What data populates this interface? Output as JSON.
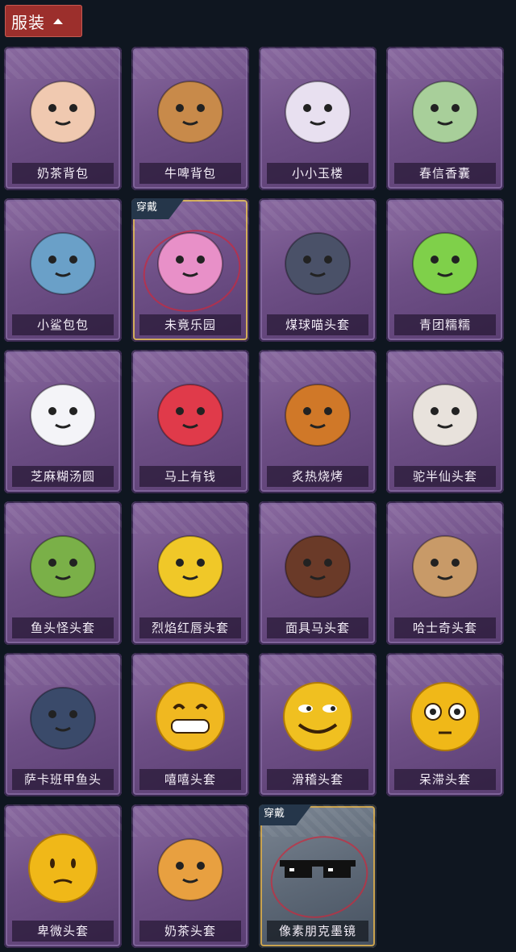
{
  "header": {
    "title": "服装"
  },
  "badge_text": "穿戴",
  "items": [
    {
      "label": "奶茶背包",
      "icon": "milk-tea-backpack-icon",
      "color": "#f0c9b0",
      "wearing": false
    },
    {
      "label": "牛啤背包",
      "icon": "beer-cow-backpack-icon",
      "color": "#c88a4a",
      "wearing": false
    },
    {
      "label": "小小玉楼",
      "icon": "small-jade-tower-icon",
      "color": "#e8e0f0",
      "wearing": false
    },
    {
      "label": "春信香囊",
      "icon": "spring-sachet-icon",
      "color": "#a8cf9a",
      "wearing": false
    },
    {
      "label": "小鲨包包",
      "icon": "shark-bag-icon",
      "color": "#6aa0c8",
      "wearing": false
    },
    {
      "label": "未竟乐园",
      "icon": "unfinished-paradise-icon",
      "color": "#e890c8",
      "wearing": true
    },
    {
      "label": "煤球喵头套",
      "icon": "coal-cat-head-icon",
      "color": "#4a5168",
      "wearing": false
    },
    {
      "label": "青团糯糯",
      "icon": "green-rice-ball-icon",
      "color": "#7fd04a",
      "wearing": false
    },
    {
      "label": "芝麻糊汤圆",
      "icon": "sesame-dumpling-icon",
      "color": "#f4f4f8",
      "wearing": false
    },
    {
      "label": "马上有钱",
      "icon": "red-horse-head-icon",
      "color": "#e03a4a",
      "wearing": false
    },
    {
      "label": "炙热烧烤",
      "icon": "grilled-meat-head-icon",
      "color": "#d07828",
      "wearing": false
    },
    {
      "label": "驼半仙头套",
      "icon": "alpaca-head-icon",
      "color": "#e8e2dc",
      "wearing": false
    },
    {
      "label": "鱼头怪头套",
      "icon": "fish-head-icon",
      "color": "#7ab048",
      "wearing": false
    },
    {
      "label": "烈焰红唇头套",
      "icon": "yellow-mask-head-icon",
      "color": "#f0c828",
      "wearing": false
    },
    {
      "label": "面具马头套",
      "icon": "horse-mask-icon",
      "color": "#6a3a28",
      "wearing": false
    },
    {
      "label": "哈士奇头套",
      "icon": "husky-head-icon",
      "color": "#c89a68",
      "wearing": false
    },
    {
      "label": "萨卡班甲鱼头",
      "icon": "sacabambaspis-head-icon",
      "color": "#3a4a6a",
      "wearing": false
    },
    {
      "label": "嘻嘻头套",
      "icon": "grin-emoji-head-icon",
      "color": "#f0b820",
      "wearing": false
    },
    {
      "label": "滑稽头套",
      "icon": "funny-emoji-head-icon",
      "color": "#f0c020",
      "wearing": false
    },
    {
      "label": "呆滞头套",
      "icon": "dazed-emoji-head-icon",
      "color": "#f0b818",
      "wearing": false
    },
    {
      "label": "卑微头套",
      "icon": "humble-emoji-head-icon",
      "color": "#f0b818",
      "wearing": false
    },
    {
      "label": "奶茶头套",
      "icon": "milk-tea-head-icon",
      "color": "#e8a040",
      "wearing": false
    },
    {
      "label": "像素朋克墨镜",
      "icon": "pixel-sunglasses-icon",
      "color": "#111111",
      "wearing": true
    }
  ]
}
